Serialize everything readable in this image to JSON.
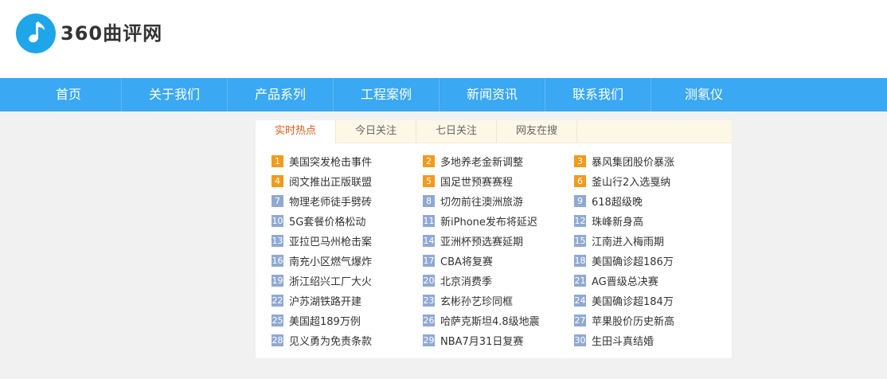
{
  "brand": {
    "name": "360曲评网",
    "accent": "#1fa6e8"
  },
  "nav": {
    "bg": "#3aa8f3",
    "items": [
      "首页",
      "关于我们",
      "产品系列",
      "工程案例",
      "新闻资讯",
      "联系我们",
      "测氡仪"
    ]
  },
  "hot": {
    "tabs": [
      {
        "label": "实时热点",
        "active": true
      },
      {
        "label": "今日关注",
        "active": false
      },
      {
        "label": "七日关注",
        "active": false
      },
      {
        "label": "网友在搜",
        "active": false
      }
    ],
    "top_color": "#f39a1c",
    "rest_color": "#8fa9d2",
    "items": [
      {
        "rank": "1",
        "title": "美国突发枪击事件"
      },
      {
        "rank": "2",
        "title": "多地养老金新调整"
      },
      {
        "rank": "3",
        "title": "暴风集团股价暴涨"
      },
      {
        "rank": "4",
        "title": "阅文推出正版联盟"
      },
      {
        "rank": "5",
        "title": "国足世预赛赛程"
      },
      {
        "rank": "6",
        "title": "釜山行2入选戛纳"
      },
      {
        "rank": "7",
        "title": "物理老师徒手劈砖"
      },
      {
        "rank": "8",
        "title": "切勿前往澳洲旅游"
      },
      {
        "rank": "9",
        "title": "618超级晚"
      },
      {
        "rank": "10",
        "title": "5G套餐价格松动"
      },
      {
        "rank": "11",
        "title": "新iPhone发布将延迟"
      },
      {
        "rank": "12",
        "title": "珠峰新身高"
      },
      {
        "rank": "13",
        "title": "亚拉巴马州枪击案"
      },
      {
        "rank": "14",
        "title": "亚洲杯预选赛延期"
      },
      {
        "rank": "15",
        "title": "江南进入梅雨期"
      },
      {
        "rank": "16",
        "title": "南充小区燃气爆炸"
      },
      {
        "rank": "17",
        "title": "CBA将复赛"
      },
      {
        "rank": "18",
        "title": "美国确诊超186万"
      },
      {
        "rank": "19",
        "title": "浙江绍兴工厂大火"
      },
      {
        "rank": "20",
        "title": "北京消费季"
      },
      {
        "rank": "21",
        "title": "AG晋级总决赛"
      },
      {
        "rank": "22",
        "title": "沪苏湖铁路开建"
      },
      {
        "rank": "23",
        "title": "玄彬孙艺珍同框"
      },
      {
        "rank": "24",
        "title": "美国确诊超184万"
      },
      {
        "rank": "25",
        "title": "美国超189万例"
      },
      {
        "rank": "26",
        "title": "哈萨克斯坦4.8级地震"
      },
      {
        "rank": "27",
        "title": "苹果股价历史新高"
      },
      {
        "rank": "28",
        "title": "见义勇为免责条款"
      },
      {
        "rank": "29",
        "title": "NBA7月31日复赛"
      },
      {
        "rank": "30",
        "title": "生田斗真结婚"
      }
    ]
  }
}
